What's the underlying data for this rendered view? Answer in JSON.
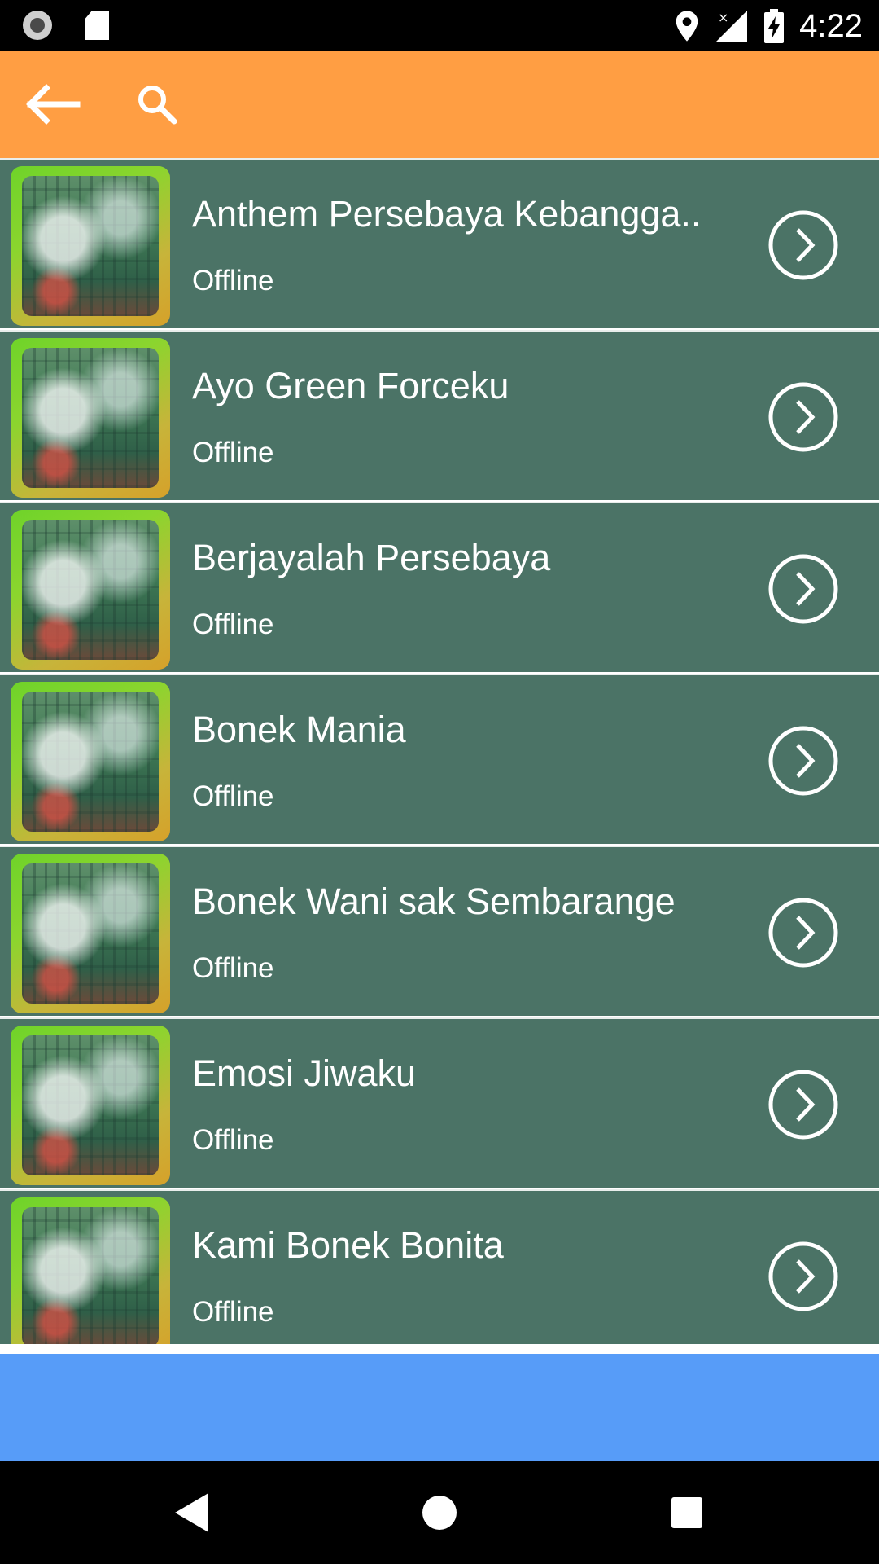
{
  "status_bar": {
    "time": "4:22",
    "left_icons": [
      "screen-record-icon",
      "sd-card-icon"
    ],
    "right_icons": [
      "location-pin-icon",
      "signal-no-service-icon",
      "battery-charging-icon"
    ]
  },
  "toolbar": {
    "back_icon": "arrow-back-icon",
    "search_icon": "search-icon",
    "background_color": "#ff9e43"
  },
  "songs": [
    {
      "title": "Anthem Persebaya Kebangga..",
      "status": "Offline"
    },
    {
      "title": "Ayo Green Forceku",
      "status": "Offline"
    },
    {
      "title": "Berjayalah Persebaya",
      "status": "Offline"
    },
    {
      "title": "Bonek Mania",
      "status": "Offline"
    },
    {
      "title": "Bonek Wani sak Sembarange",
      "status": "Offline"
    },
    {
      "title": "Emosi Jiwaku",
      "status": "Offline"
    },
    {
      "title": "Kami Bonek Bonita",
      "status": "Offline"
    }
  ],
  "colors": {
    "list_item_background": "#4b7366",
    "ad_banner": "#579cf8",
    "nav_bar": "#000000"
  },
  "nav_bar": {
    "icons": [
      "back-triangle-icon",
      "home-circle-icon",
      "recents-square-icon"
    ]
  }
}
